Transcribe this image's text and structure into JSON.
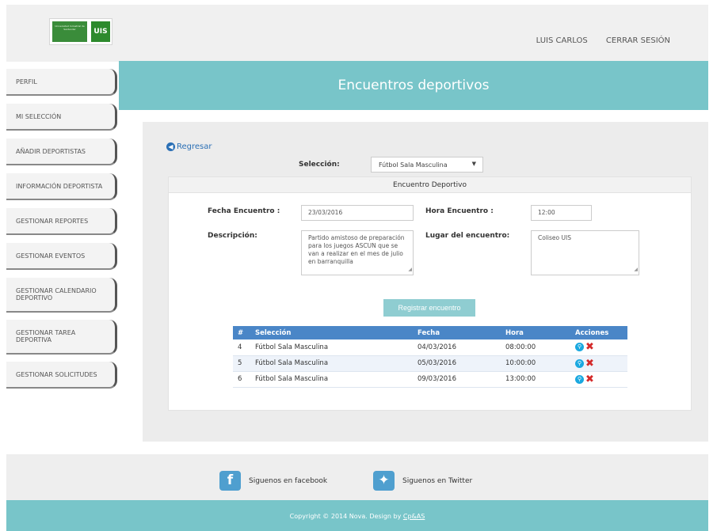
{
  "header": {
    "logo_text": "Universidad Industrial de Santander",
    "logo_mark": "UIS",
    "user_name": "LUIS CARLOS",
    "logout_label": "CERRAR SESIÓN"
  },
  "sidebar": {
    "items": [
      {
        "label": "PERFIL"
      },
      {
        "label": "MI SELECCIÓN"
      },
      {
        "label": "AÑADIR DEPORTISTAS"
      },
      {
        "label": "INFORMACIÓN DEPORTISTA"
      },
      {
        "label": "GESTIONAR REPORTES"
      },
      {
        "label": "GESTIONAR EVENTOS"
      },
      {
        "label": "GESTIONAR CALENDARIO DEPORTIVO"
      },
      {
        "label": "GESTIONAR TAREA DEPORTIVA"
      },
      {
        "label": "GESTIONAR SOLICITUDES"
      }
    ]
  },
  "page_title": "Encuentros deportivos",
  "back_label": "Regresar",
  "selection": {
    "label": "Selección:",
    "value": "Fútbol Sala Masculina"
  },
  "form": {
    "card_title": "Encuentro Deportivo",
    "date_label": "Fecha Encuentro :",
    "date_value": "23/03/2016",
    "time_label": "Hora Encuentro :",
    "time_value": "12:00",
    "description_label": "Descripción:",
    "description_value": "Partido amistoso de preparación para los juegos ASCUN que se van a realizar en el mes de julio en barranquilla",
    "place_label": "Lugar del encuentro:",
    "place_value": "Coliseo UIS",
    "submit_label": "Registrar encuentro"
  },
  "table": {
    "headers": [
      "#",
      "Selección",
      "Fecha",
      "Hora",
      "Acciones"
    ],
    "rows": [
      {
        "num": "4",
        "selection": "Fútbol Sala Masculina",
        "date": "04/03/2016",
        "time": "08:00:00"
      },
      {
        "num": "5",
        "selection": "Fútbol Sala Masculina",
        "date": "05/03/2016",
        "time": "10:00:00"
      },
      {
        "num": "6",
        "selection": "Fútbol Sala Masculina",
        "date": "09/03/2016",
        "time": "13:00:00"
      }
    ]
  },
  "footer": {
    "facebook_label": "Siguenos en facebook",
    "twitter_label": "Siguenos en Twitter",
    "copyright": "Copyright © 2014 Nova. Design by ",
    "designer": "Cp&AS"
  },
  "colors": {
    "accent_teal": "#78c5c9",
    "table_header": "#4a86c7",
    "delete_red": "#d42a2a"
  }
}
